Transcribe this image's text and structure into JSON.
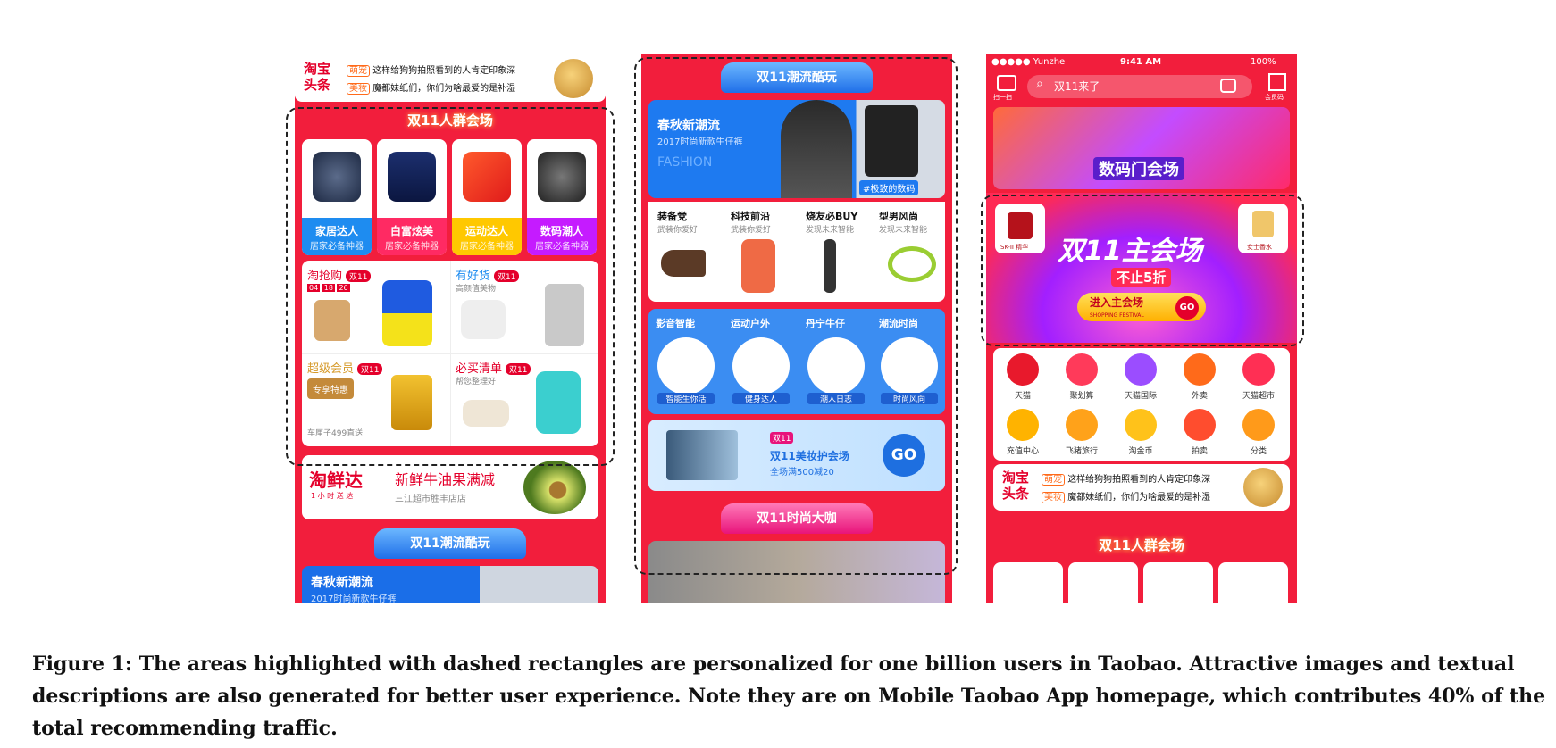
{
  "screen1": {
    "toutiao_logo": "淘宝头条",
    "toutiao_tag1": "萌宠",
    "toutiao_line1": "这样给狗狗拍照看到的人肯定印象深",
    "toutiao_tag2": "美妆",
    "toutiao_line2": "魔都妹纸们，你们为啥最爱的是补湿",
    "section_title": "双11人群会场",
    "categories": [
      {
        "title": "家居达人",
        "subtitle": "居家必备神器"
      },
      {
        "title": "白富炫美",
        "subtitle": "居家必备神器"
      },
      {
        "title": "运动达人",
        "subtitle": "居家必备神器"
      },
      {
        "title": "数码潮人",
        "subtitle": "居家必备神器"
      }
    ],
    "promo_a_title": "淘抢购",
    "promo_a_badge": "双11",
    "promo_a_timer": [
      "04",
      "18",
      "26"
    ],
    "promo_b_title": "有好货",
    "promo_b_badge": "双11",
    "promo_b_sub": "高颜值美物",
    "promo_c_title": "超级会员",
    "promo_c_badge": "双11",
    "promo_c_ticket": "专享特惠",
    "promo_c_bottom": "车厘子499直送",
    "promo_d_title": "必买清单",
    "promo_d_badge": "双11",
    "promo_d_sub": "帮您整理好",
    "xianda_logo": "淘鲜达",
    "xianda_logo_sub": "1 小 时 送 达",
    "xianda_title": "新鲜牛油果满减",
    "xianda_sub": "三江超市胜丰店店",
    "trend_tab": "双11潮流酷玩",
    "trend_title": "春秋新潮流",
    "trend_sub": "2017时尚新款牛仔裤"
  },
  "screen2": {
    "trend_tab": "双11潮流酷玩",
    "hero_title": "春秋新潮流",
    "hero_sub": "2017时尚新款牛仔裤",
    "hero_watermark": "FASHION",
    "hero_tag": "#极致的数码",
    "row1": [
      {
        "title": "装备党",
        "sub": "武装你爱好"
      },
      {
        "title": "科技前沿",
        "sub": "武装你爱好"
      },
      {
        "title": "烧友必BUY",
        "sub": "发现未来智能"
      },
      {
        "title": "型男风尚",
        "sub": "发现未来智能"
      }
    ],
    "row2": [
      {
        "title": "影音智能",
        "badge": "智能生你活"
      },
      {
        "title": "运动户外",
        "badge": "健身达人"
      },
      {
        "title": "丹宁牛仔",
        "badge": "潮人日志"
      },
      {
        "title": "潮流时尚",
        "badge": "时尚风向"
      }
    ],
    "beauty_badge": "双11",
    "beauty_title": "双11美妆护会场",
    "beauty_sub": "全场满500减20",
    "go": "GO",
    "fashion_tab": "双11时尚大咖"
  },
  "screen3": {
    "status_carrier": "●●●●● Yunzhe",
    "status_time": "9:41 AM",
    "status_battery": "100%",
    "scan_label": "扫一扫",
    "search_text": "双11来了",
    "member_label": "会员码",
    "top_banner": "数码门会场",
    "left_product": "SK-II 精华",
    "right_product": "女士香水",
    "main_title": "双11主会场",
    "main_discount": "不止5折",
    "main_button": "进入主会场",
    "main_button_sub": "SHOPPING FESTIVAL",
    "go": "GO",
    "icons": [
      "天猫",
      "聚划算",
      "天猫国际",
      "外卖",
      "天猫超市",
      "充值中心",
      "飞猪旅行",
      "淘金币",
      "拍卖",
      "分类"
    ],
    "icon_colors": [
      "#e8192c",
      "#ff3a5a",
      "#9b4dff",
      "#ff6a1a",
      "#ff2f54",
      "#ffb300",
      "#ffa21a",
      "#ffc21a",
      "#ff4d2e",
      "#ff9a1a"
    ],
    "toutiao_logo": "淘宝头条",
    "toutiao_tag1": "萌宠",
    "toutiao_line1": "这样给狗狗拍照看到的人肯定印象深",
    "toutiao_tag2": "美妆",
    "toutiao_line2": "魔都妹纸们，你们为啥最爱的是补湿",
    "section_title": "双11人群会场"
  },
  "caption": "Figure 1: The areas highlighted with dashed rectangles are personalized for one billion users in Taobao. Attractive images and textual descriptions are also generated for better user experience. Note they are on Mobile Taobao App homepage, which contributes 40% of the total recommending traffic."
}
